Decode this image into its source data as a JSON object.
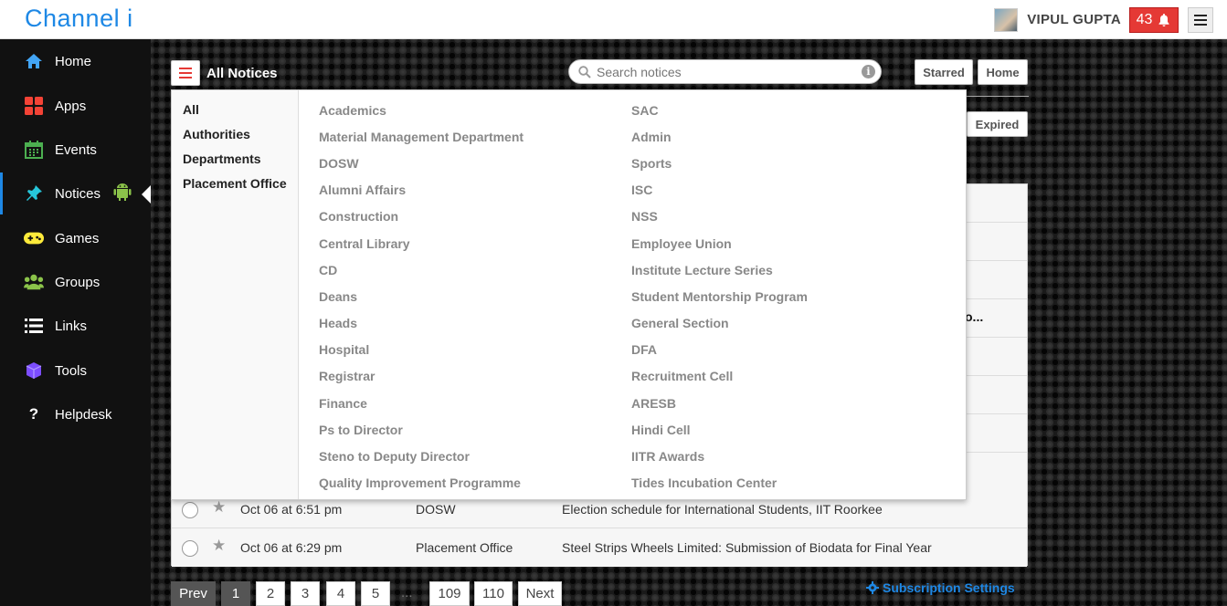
{
  "app": {
    "brand": "Channel i"
  },
  "user": {
    "name": "VIPUL GUPTA",
    "notification_count": "43"
  },
  "sidebar": {
    "items": [
      {
        "label": "Home",
        "icon": "home-icon",
        "color": "#42a5f5"
      },
      {
        "label": "Apps",
        "icon": "apps-icon",
        "color": "#f44336"
      },
      {
        "label": "Events",
        "icon": "calendar-icon",
        "color": "#4caf50"
      },
      {
        "label": "Notices",
        "icon": "pin-icon",
        "color": "#26c6da",
        "active": true
      },
      {
        "label": "Games",
        "icon": "gamepad-icon",
        "color": "#ffeb3b"
      },
      {
        "label": "Groups",
        "icon": "groups-icon",
        "color": "#8bc34a"
      },
      {
        "label": "Links",
        "icon": "list-icon",
        "color": "#ffffff"
      },
      {
        "label": "Tools",
        "icon": "cube-icon",
        "color": "#7c4dff"
      },
      {
        "label": "Helpdesk",
        "icon": "question-icon",
        "color": "#ffffff"
      }
    ]
  },
  "header": {
    "title": "All Notices",
    "search_placeholder": "Search notices",
    "starred_label": "Starred",
    "home_label": "Home",
    "expired_label": "Expired"
  },
  "dropdown": {
    "categories": [
      "All",
      "Authorities",
      "Departments",
      "Placement Office"
    ],
    "column1": [
      "Academics",
      "Material Management Department",
      "DOSW",
      "Alumni Affairs",
      "Construction",
      "Central Library",
      "CD",
      "Deans",
      "Heads",
      "Hospital",
      "Registrar",
      "Finance",
      "Ps to Director",
      "Steno to Deputy Director",
      "Quality Improvement Programme"
    ],
    "column2": [
      "SAC",
      "Admin",
      "Sports",
      "ISC",
      "NSS",
      "Employee Union",
      "Institute Lecture Series",
      "Student Mentorship Program",
      "General Section",
      "DFA",
      "Recruitment Cell",
      "ARESB",
      "Hindi Cell",
      "IITR Awards",
      "Tides Incubation Center"
    ]
  },
  "notices": {
    "truncated_text": "o...",
    "rows": [
      {
        "date": "Oct 06 at 6:51 pm",
        "source": "DOSW",
        "subject": "Election schedule for International Students, IIT Roorkee"
      },
      {
        "date": "Oct 06 at 6:29 pm",
        "source": "Placement Office",
        "subject": "Steel Strips Wheels Limited: Submission of Biodata for Final Year"
      }
    ]
  },
  "pagination": {
    "prev": "Prev",
    "pages": [
      "1",
      "2",
      "3",
      "4",
      "5"
    ],
    "ellipsis": "...",
    "last_pages": [
      "109",
      "110"
    ],
    "next": "Next",
    "current": "1"
  },
  "subscription_label": "Subscription Settings"
}
